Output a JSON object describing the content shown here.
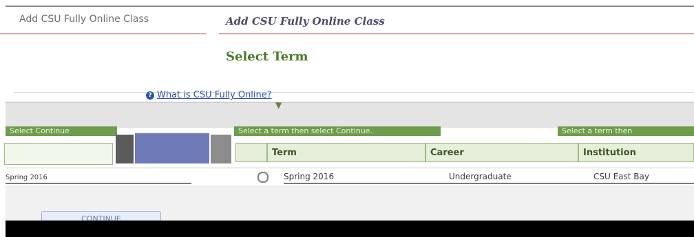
{
  "breadcrumb": "Add CSU Fully Online Class",
  "page_title": "Add CSU Fully Online Class",
  "subtitle": "Select Term",
  "help_link": "What is CSU Fully Online?",
  "sections": {
    "left": "Select Continue",
    "middle": "Select a term then select Continue.",
    "right": "Select a term then"
  },
  "table": {
    "headers": [
      "Term",
      "Career",
      "Institution"
    ],
    "rows": [
      {
        "left_text": "Spring 2016",
        "term": "Spring 2016",
        "career": "Undergraduate",
        "institution": "CSU East Bay"
      }
    ]
  },
  "continue_label": "CONTINUE",
  "colors": {
    "accent_green": "#6e9d4c",
    "header_bg": "#e6efd9",
    "title": "#4a7a2a"
  }
}
